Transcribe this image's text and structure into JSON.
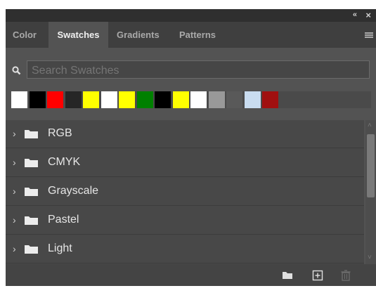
{
  "panel": {
    "collapse_label": "«",
    "close_label": "×"
  },
  "tabs": [
    {
      "label": "Color",
      "active": false
    },
    {
      "label": "Swatches",
      "active": true
    },
    {
      "label": "Gradients",
      "active": false
    },
    {
      "label": "Patterns",
      "active": false
    }
  ],
  "search": {
    "placeholder": "Search Swatches",
    "value": ""
  },
  "recent_swatches": [
    "#ffffff",
    "#000000",
    "#ff0000",
    "#262626",
    "#ffff00",
    "#ffffff",
    "#ffff00",
    "#008000",
    "#000000",
    "#ffff00",
    "#ffffff",
    "#999999",
    "#595959",
    "#c9dcf0",
    "#a01010"
  ],
  "groups": [
    {
      "label": "RGB"
    },
    {
      "label": "CMYK"
    },
    {
      "label": "Grayscale"
    },
    {
      "label": "Pastel"
    },
    {
      "label": "Light"
    }
  ],
  "icons": {
    "search": "search-icon",
    "menu": "panel-menu-icon",
    "folder": "folder-icon",
    "chevron": "chevron-right-icon",
    "new_group": "new-group-folder-icon",
    "new_swatch": "new-swatch-icon",
    "delete": "trash-icon"
  },
  "colors": {
    "panel_bg": "#535353",
    "tabbar_bg": "#3f3f3f",
    "text": "#e6e6e6"
  }
}
